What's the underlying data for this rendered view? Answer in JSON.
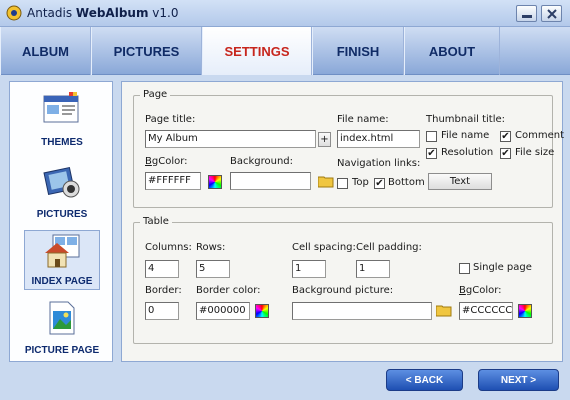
{
  "window": {
    "title_prefix": "Antadis ",
    "title_bold": "WebAlbum",
    "title_version": " v1.0"
  },
  "tabs": [
    {
      "label": "ALBUM"
    },
    {
      "label": "PICTURES"
    },
    {
      "label": "SETTINGS",
      "active": true
    },
    {
      "label": "FINISH"
    },
    {
      "label": "ABOUT"
    }
  ],
  "sidebar": {
    "items": [
      {
        "label": "THEMES"
      },
      {
        "label": "PICTURES"
      },
      {
        "label": "INDEX PAGE",
        "active": true
      },
      {
        "label": "PICTURE PAGE"
      }
    ]
  },
  "page_group": {
    "legend": "Page",
    "page_title_label": "Page title:",
    "page_title_value": "My Album",
    "plus_label": "+",
    "file_name_label": "File name:",
    "file_name_value": "index.html",
    "bgcolor_label_first": "B",
    "bgcolor_label_rest": "gColor:",
    "bgcolor_value": "#FFFFFF",
    "background_label": "Background:",
    "background_value": "",
    "nav_links_label": "Navigation links:",
    "nav_top_label": "Top",
    "nav_top_checked": false,
    "nav_bottom_label": "Bottom",
    "nav_bottom_checked": true,
    "thumb_title_label": "Thumbnail title:",
    "thumb_file_name_label": "File name",
    "thumb_file_name_checked": false,
    "thumb_comment_label": "Comment",
    "thumb_comment_checked": true,
    "thumb_resolution_label": "Resolution",
    "thumb_resolution_checked": true,
    "thumb_file_size_label": "File size",
    "thumb_file_size_checked": true,
    "text_button_label": "Text"
  },
  "table_group": {
    "legend": "Table",
    "columns_label": "Columns:",
    "columns_value": "4",
    "rows_label": "Rows:",
    "rows_value": "5",
    "cell_spacing_label": "Cell spacing:",
    "cell_spacing_value": "1",
    "cell_padding_label": "Cell padding:",
    "cell_padding_value": "1",
    "single_page_label": "Single page",
    "single_page_checked": false,
    "border_label": "Border:",
    "border_value": "0",
    "border_color_label": "Border color:",
    "border_color_value": "#000000",
    "bg_picture_label": "Background picture:",
    "bg_picture_value": "",
    "bgcolor_label_first": "B",
    "bgcolor_label_rest": "gColor:",
    "bgcolor_value": "#CCCCCC"
  },
  "footer": {
    "back_label": "< BACK",
    "next_label": "NEXT >"
  },
  "colors": {
    "accent": "#c7261d",
    "tab_text": "#102b66",
    "nav_button": "#2b5fc4"
  },
  "check_glyph": "✔"
}
